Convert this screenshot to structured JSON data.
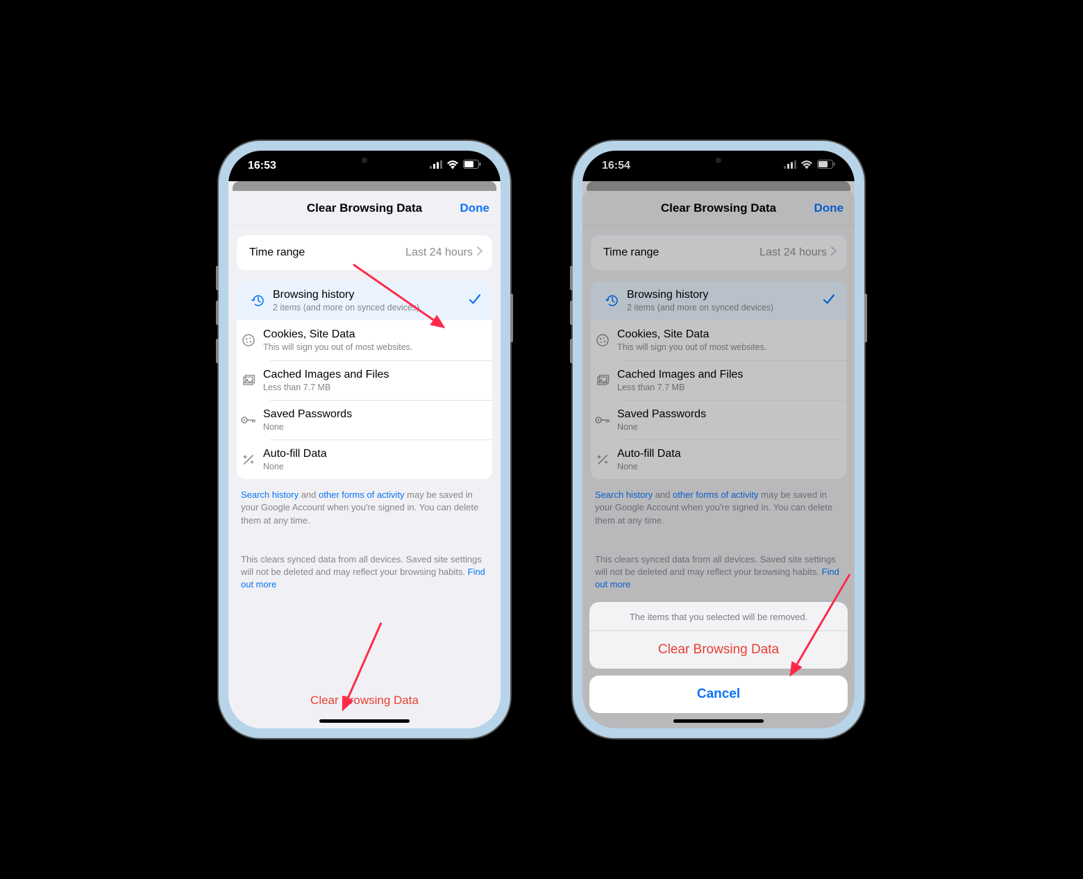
{
  "phone1": {
    "time": "16:53",
    "header": {
      "title": "Clear Browsing Data",
      "done": "Done"
    },
    "time_range": {
      "label": "Time range",
      "value": "Last 24 hours"
    },
    "items": [
      {
        "title": "Browsing history",
        "sub": "2 items (and more on synced devices)",
        "selected": true
      },
      {
        "title": "Cookies, Site Data",
        "sub": "This will sign you out of most websites.",
        "selected": false
      },
      {
        "title": "Cached Images and Files",
        "sub": "Less than 7.7 MB",
        "selected": false
      },
      {
        "title": "Saved Passwords",
        "sub": "None",
        "selected": false
      },
      {
        "title": "Auto-fill Data",
        "sub": "None",
        "selected": false
      }
    ],
    "footer1": {
      "link1": "Search history",
      "mid1": " and ",
      "link2": "other forms of activity",
      "rest": " may be saved in your Google Account when you're signed in. You can delete them at any time."
    },
    "footer2": {
      "text": "This clears synced data from all devices. Saved site settings will not be deleted and may reflect your browsing habits. ",
      "link": "Find out more"
    },
    "clear_btn": "Clear Browsing Data"
  },
  "phone2": {
    "time": "16:54",
    "header": {
      "title": "Clear Browsing Data",
      "done": "Done"
    },
    "time_range": {
      "label": "Time range",
      "value": "Last 24 hours"
    },
    "items": [
      {
        "title": "Browsing history",
        "sub": "2 items (and more on synced devices)",
        "selected": true
      },
      {
        "title": "Cookies, Site Data",
        "sub": "This will sign you out of most websites.",
        "selected": false
      },
      {
        "title": "Cached Images and Files",
        "sub": "Less than 7.7 MB",
        "selected": false
      },
      {
        "title": "Saved Passwords",
        "sub": "None",
        "selected": false
      },
      {
        "title": "Auto-fill Data",
        "sub": "None",
        "selected": false
      }
    ],
    "footer1": {
      "link1": "Search history",
      "mid1": " and ",
      "link2": "other forms of activity",
      "rest": " may be saved in your Google Account when you're signed in. You can delete them at any time."
    },
    "footer2": {
      "text": "This clears synced data from all devices. Saved site settings will not be deleted and may reflect your browsing habits. ",
      "link": "Find out more"
    },
    "action_sheet": {
      "message": "The items that you selected will be removed.",
      "destructive": "Clear Browsing Data",
      "cancel": "Cancel"
    }
  }
}
